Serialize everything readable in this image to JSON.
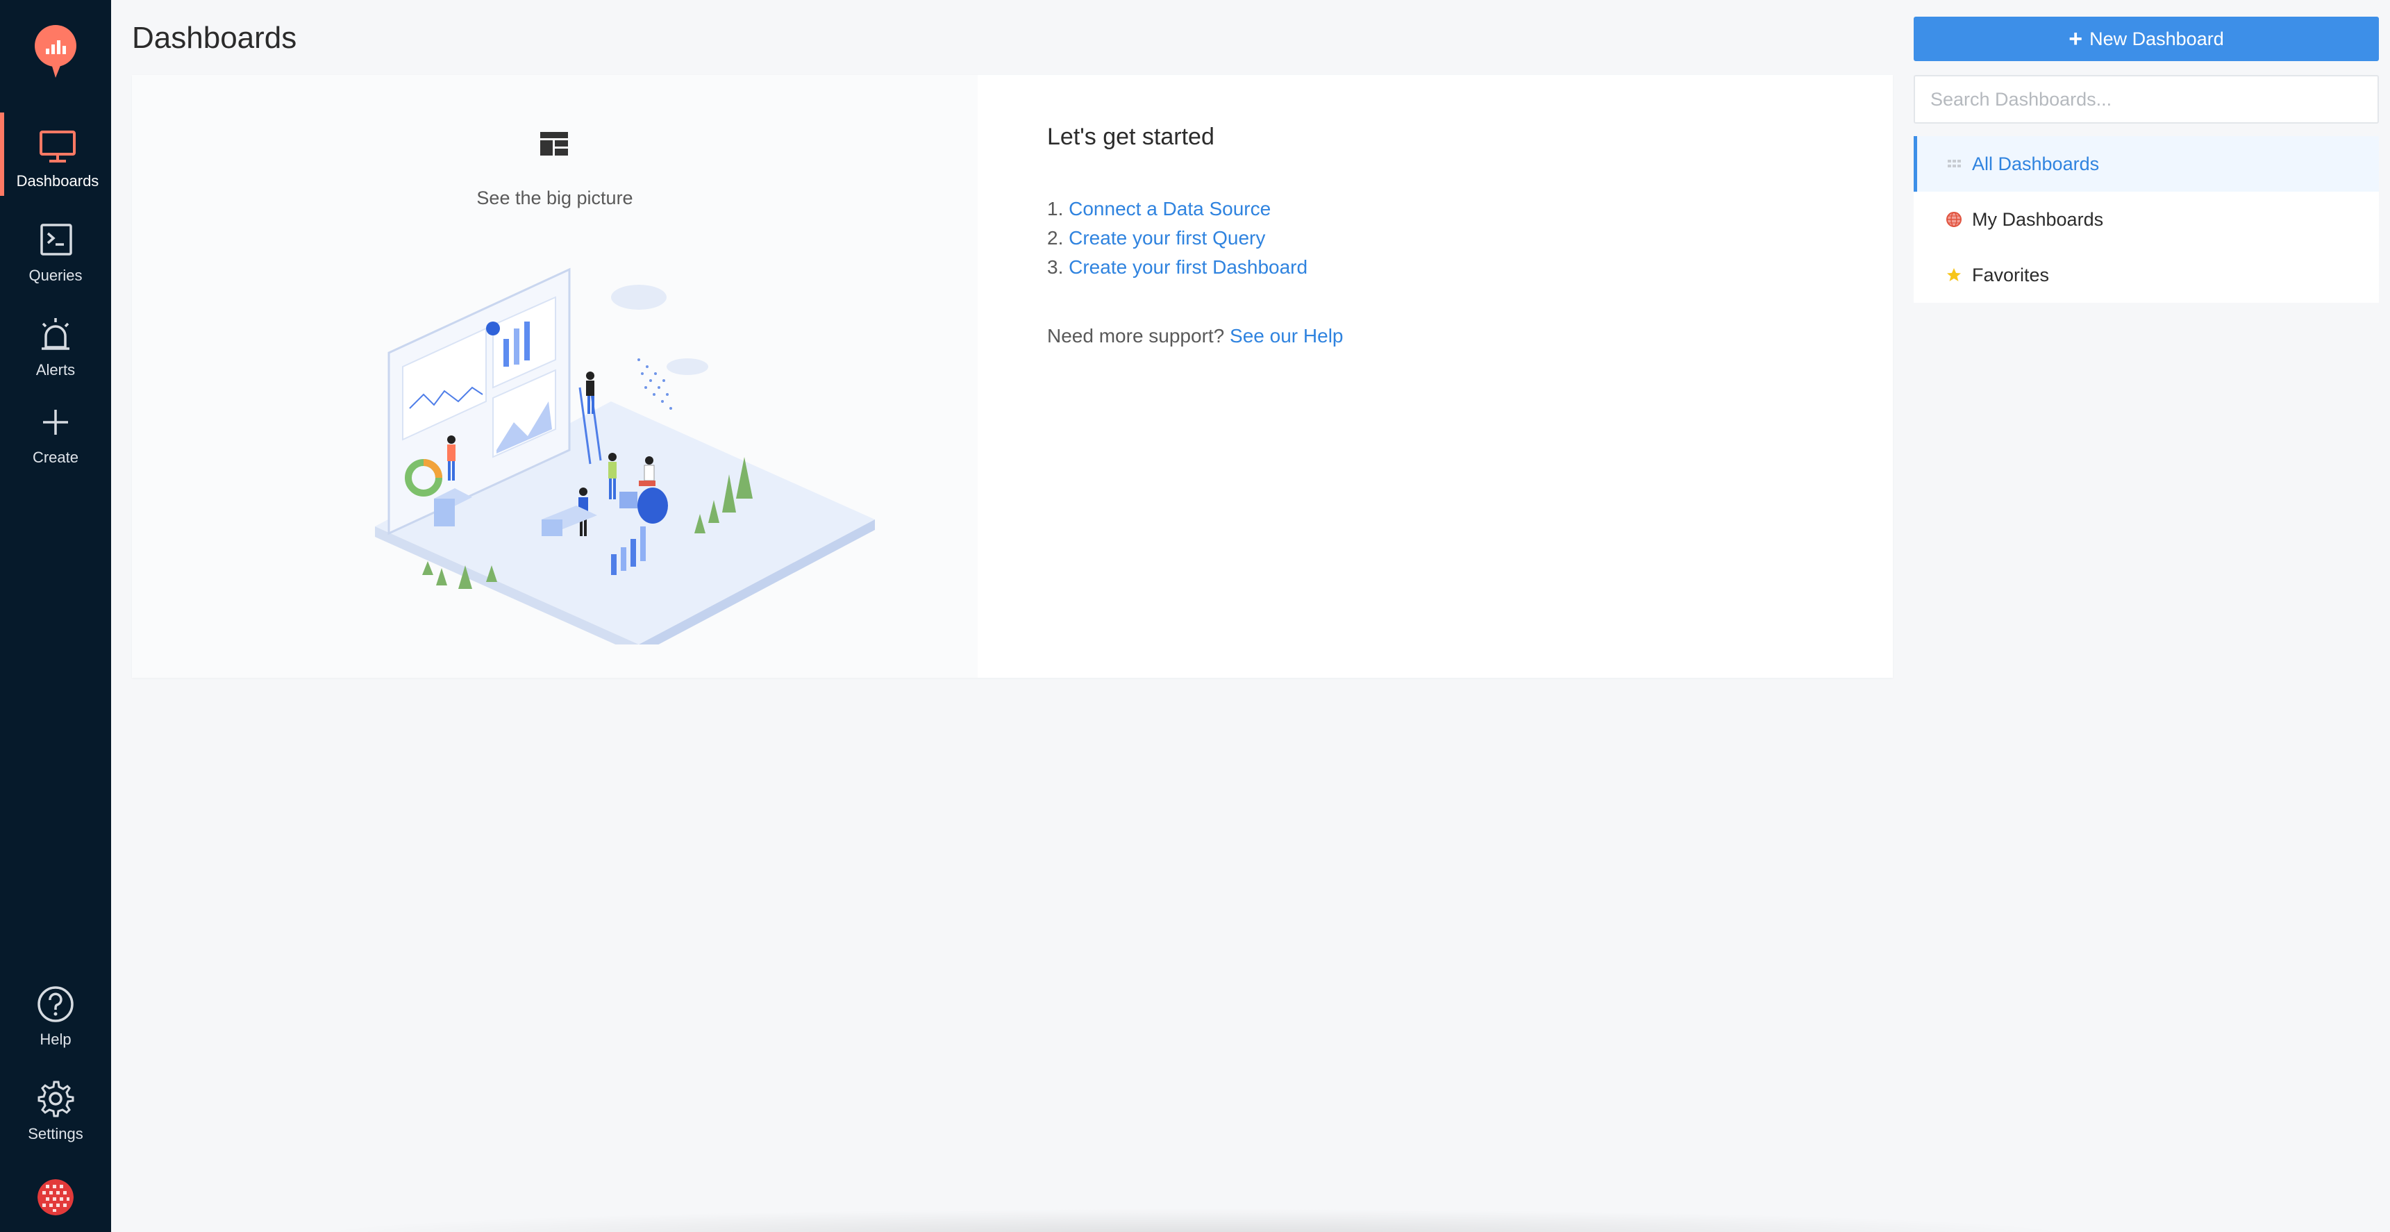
{
  "sidebar": {
    "items": [
      {
        "label": "Dashboards",
        "icon": "monitor-icon",
        "active": true
      },
      {
        "label": "Queries",
        "icon": "terminal-icon"
      },
      {
        "label": "Alerts",
        "icon": "siren-icon"
      },
      {
        "label": "Create",
        "icon": "plus-icon"
      }
    ],
    "bottom_items": [
      {
        "label": "Help",
        "icon": "question-circle-icon"
      },
      {
        "label": "Settings",
        "icon": "gear-icon"
      }
    ],
    "accent_color": "#ff7964"
  },
  "page": {
    "title": "Dashboards"
  },
  "empty_state": {
    "caption": "See the big picture",
    "heading": "Let's get started",
    "steps": [
      {
        "number": "1.",
        "link": "Connect a Data Source"
      },
      {
        "number": "2.",
        "link": "Create your first Query"
      },
      {
        "number": "3.",
        "link": "Create your first Dashboard"
      }
    ],
    "support_text": "Need more support?",
    "support_link": "See our Help"
  },
  "actions": {
    "new_dashboard_label": "New Dashboard",
    "primary_color": "#3d8fe8"
  },
  "search": {
    "placeholder": "Search Dashboards..."
  },
  "filters": [
    {
      "label": "All Dashboards",
      "icon": "grid-icon",
      "active": true
    },
    {
      "label": "My Dashboards",
      "icon": "globe-icon"
    },
    {
      "label": "Favorites",
      "icon": "star-icon"
    }
  ]
}
